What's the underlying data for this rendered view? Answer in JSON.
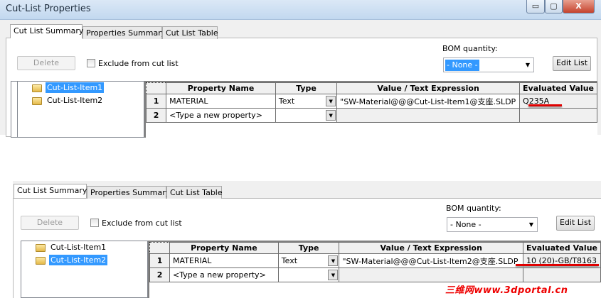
{
  "window": {
    "title": "Cut-List Properties",
    "minimize": "▭",
    "maximize": "▢",
    "close": "X"
  },
  "tabs": [
    "Cut List Summary",
    "Properties Summary",
    "Cut List Table"
  ],
  "delete_label": "Delete",
  "exclude_label": "Exclude from cut list",
  "bom_label": "BOM quantity:",
  "bom_value": "- None -",
  "edit_list_label": "Edit List",
  "tree_items": [
    "Cut-List-Item1",
    "Cut-List-Item2"
  ],
  "columns": [
    "Property Name",
    "Type",
    "Value / Text Expression",
    "Evaluated Value"
  ],
  "panel1": {
    "selected_item": "Cut-List-Item1",
    "rows": [
      {
        "num": "1",
        "property": "MATERIAL",
        "type": "Text",
        "expression": "\"SW-Material@@@Cut-List-Item1@支座.SLDP",
        "evaluated": "Q235A"
      },
      {
        "num": "2",
        "property": "<Type a new property>",
        "type": "",
        "expression": "",
        "evaluated": ""
      }
    ]
  },
  "panel2": {
    "selected_item": "Cut-List-Item2",
    "rows": [
      {
        "num": "1",
        "property": "MATERIAL",
        "type": "Text",
        "expression": "\"SW-Material@@@Cut-List-Item2@支座.SLDP",
        "evaluated": "10 (20)-GB/T8163"
      },
      {
        "num": "2",
        "property": "<Type a new property>",
        "type": "",
        "expression": "",
        "evaluated": ""
      }
    ]
  },
  "watermark": "三维网www.3dportal.cn",
  "colors": {
    "selection": "#3399ff",
    "highlight_underline": "#e00000"
  }
}
